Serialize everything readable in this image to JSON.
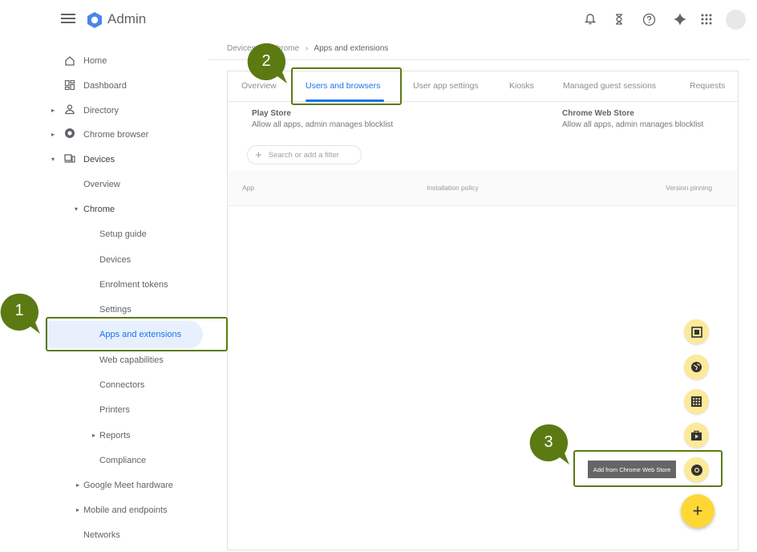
{
  "app": {
    "title": "Admin"
  },
  "breadcrumb": {
    "part1": "Devices",
    "part2": "Chrome",
    "separator": "›",
    "current": "Apps and extensions"
  },
  "sidebar": {
    "home": "Home",
    "dashboard": "Dashboard",
    "directory": "Directory",
    "chrome_browser": "Chrome browser",
    "devices": "Devices",
    "overview": "Overview",
    "chrome": "Chrome",
    "setup_guide": "Setup guide",
    "devices_sub": "Devices",
    "enrolment_tokens": "Enrolment tokens",
    "settings": "Settings",
    "apps_and_extensions": "Apps and extensions",
    "web_capabilities": "Web capabilities",
    "connectors": "Connectors",
    "printers": "Printers",
    "reports": "Reports",
    "compliance": "Compliance",
    "google_meet_hardware": "Google Meet hardware",
    "mobile_and_endpoints": "Mobile and endpoints",
    "networks": "Networks"
  },
  "tabs": {
    "overview": "Overview",
    "users_and_browsers": "Users and browsers",
    "user_app_settings": "User app settings",
    "kiosks": "Kiosks",
    "managed_guest_sessions": "Managed guest sessions",
    "requests": "Requests"
  },
  "stores": {
    "play_title": "Play Store",
    "play_sub": "Allow all apps, admin manages blocklist",
    "cws_title": "Chrome Web Store",
    "cws_sub": "Allow all apps, admin manages blocklist"
  },
  "filter": {
    "placeholder": "Search or add a filter",
    "plus": "+"
  },
  "table": {
    "col_app": "App",
    "col_policy": "Installation policy",
    "col_version": "Version pinning"
  },
  "fab": {
    "label": "+",
    "tooltip": "Add from Chrome Web Store"
  },
  "callouts": {
    "one": "1",
    "two": "2",
    "three": "3"
  },
  "colors": {
    "accent": "#1a73e8",
    "callout": "#5b7a12",
    "fab": "#fdd835",
    "mini_fab": "#fde99a",
    "active_bg": "#e8f0fe"
  },
  "icons": {
    "top": [
      "bell-icon",
      "hourglass-icon",
      "help-icon",
      "sparkle-icon",
      "apps-grid-icon"
    ],
    "fabs": [
      "android-app-icon",
      "web-app-icon",
      "grid-app-icon",
      "play-store-icon",
      "chrome-icon"
    ]
  }
}
